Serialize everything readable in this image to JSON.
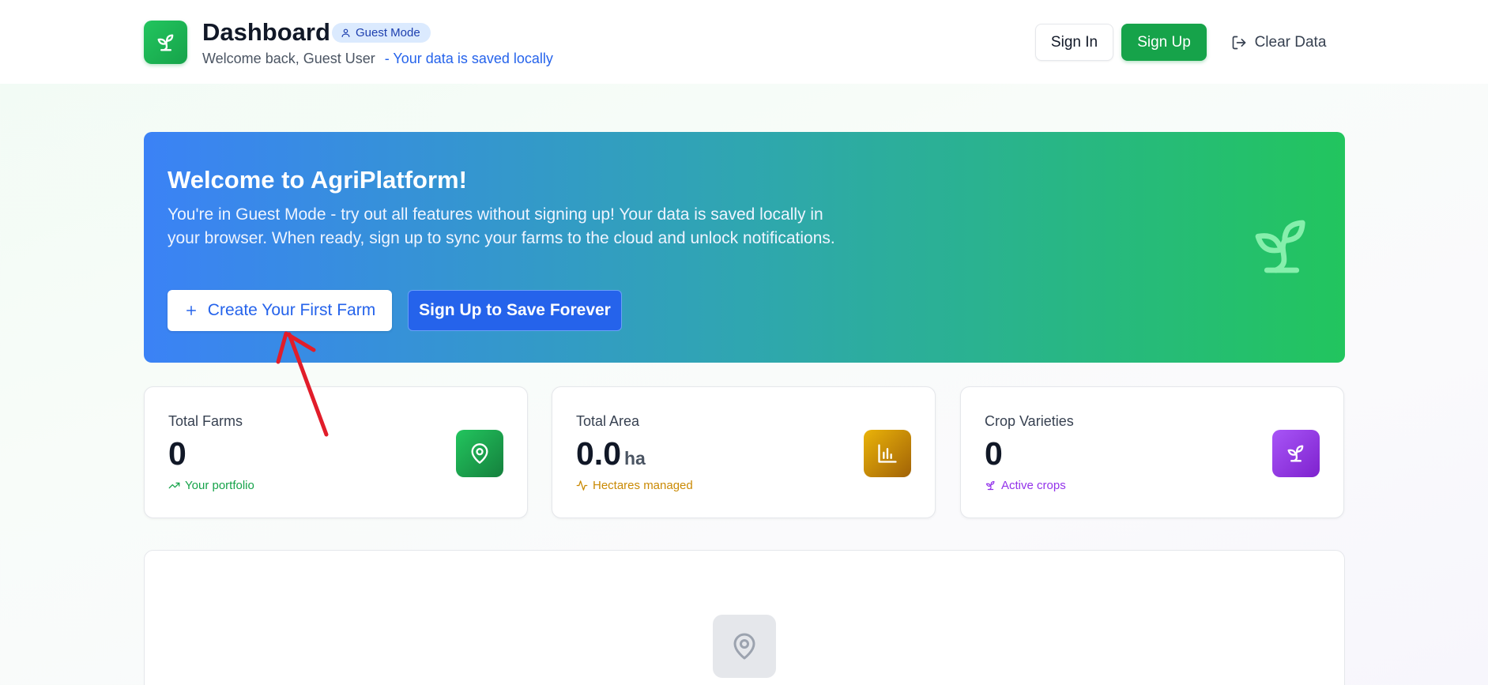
{
  "header": {
    "title": "Dashboard",
    "badge": "Guest Mode",
    "welcome": "Welcome back, Guest User",
    "saved_note": "- Your data is saved locally",
    "signin_label": "Sign In",
    "signup_label": "Sign Up",
    "clear_label": "Clear Data"
  },
  "hero": {
    "title": "Welcome to AgriPlatform!",
    "description": "You're in Guest Mode - try out all features without signing up! Your data is saved locally in your browser. When ready, sign up to sync your farms to the cloud and unlock notifications.",
    "create_label": "Create Your First Farm",
    "save_forever_label": "Sign Up to Save Forever"
  },
  "stats": [
    {
      "label": "Total Farms",
      "value": "0",
      "unit": "",
      "sub": "Your portfolio",
      "icon": "map-pin-icon",
      "color": "#16a34a"
    },
    {
      "label": "Total Area",
      "value": "0.0",
      "unit": "ha",
      "sub": "Hectares managed",
      "icon": "bar-chart-icon",
      "color": "#ca8a04"
    },
    {
      "label": "Crop Varieties",
      "value": "0",
      "unit": "",
      "sub": "Active crops",
      "icon": "sprout-icon",
      "color": "#9333ea"
    }
  ],
  "empty_state": {
    "icon": "map-pin-icon"
  },
  "colors": {
    "primary_green": "#16a34a",
    "primary_blue": "#2563eb",
    "badge_bg": "#dbeafe",
    "annotation_red": "#e11d2a"
  }
}
